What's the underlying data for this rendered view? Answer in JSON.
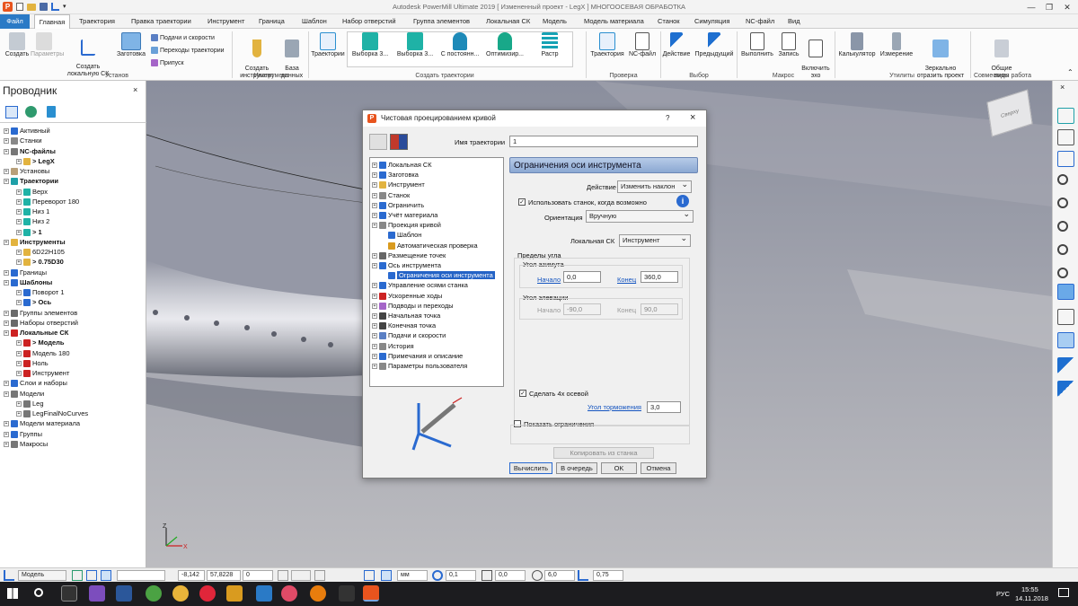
{
  "window": {
    "title": "Autodesk PowerMill Ultimate 2019   [ Измененный проект - LegX ]   МНОГООСЕВАЯ ОБРАБОТКА",
    "quick_access": "▾"
  },
  "menu_tabs": [
    "Файл",
    "Главная",
    "Траектория",
    "Правка траектории",
    "Инструмент",
    "Граница",
    "Шаблон",
    "Набор отверстий",
    "Группа элементов",
    "Локальная СК",
    "Модель",
    "Модель материала",
    "Станок",
    "Симуляция",
    "NC-файл",
    "Вид"
  ],
  "ribbon": {
    "buttons": {
      "create": "Создать",
      "params": "Параметры",
      "create_lcs": "Создать\nлокальную СК",
      "stock": "Заготовка",
      "feeds": "Подачи и скорости",
      "transitions": "Переходы траектории",
      "allowance": "Припуск",
      "create_tool": "Создать\nинструмент",
      "database": "База\nданных",
      "toolpaths": "Траектории",
      "g1": "Выборка 3...",
      "g2": "Выборка 3...",
      "g3": "С постоянн...",
      "g4": "Оптимизир...",
      "g5": "Растр",
      "verify_tp": "Траектория",
      "verify_nc": "NC-файл",
      "select_action": "Действие",
      "select_prev": "Предыдущий",
      "run": "Выполнить",
      "record": "Запись",
      "echo": "Включить\nэхо",
      "calculator": "Калькулятор",
      "measure": "Измерение",
      "mirror": "Зеркально\nотразить проект",
      "shared_views": "Общие\nвиды"
    },
    "groups": {
      "setup": "Установ",
      "tool": "Инструмент",
      "create_toolpaths": "Создать траектории",
      "verify": "Проверка",
      "selection": "Выбор",
      "macro": "Макрос",
      "utilities": "Утилиты",
      "collab": "Совместная работа"
    }
  },
  "explorer": {
    "title": "Проводник",
    "close": "×",
    "rows": [
      {
        "text": "Активный",
        "bold": false,
        "indent": 0
      },
      {
        "text": "Станки",
        "bold": false,
        "indent": 0
      },
      {
        "text": "NC-файлы",
        "bold": true,
        "indent": 0
      },
      {
        "text": "> LegX",
        "bold": true,
        "indent": 1
      },
      {
        "text": "Установы",
        "bold": false,
        "indent": 0
      },
      {
        "text": "Траектории",
        "bold": true,
        "indent": 0
      },
      {
        "text": "Верх",
        "bold": false,
        "indent": 1
      },
      {
        "text": "Переворот 180",
        "bold": false,
        "indent": 1
      },
      {
        "text": "Низ 1",
        "bold": false,
        "indent": 1
      },
      {
        "text": "Низ 2",
        "bold": false,
        "indent": 1
      },
      {
        "text": "> 1",
        "bold": true,
        "indent": 1
      },
      {
        "text": "Инструменты",
        "bold": true,
        "indent": 0
      },
      {
        "text": "6D22H105",
        "bold": false,
        "indent": 1
      },
      {
        "text": "> 0.75D30",
        "bold": true,
        "indent": 1
      },
      {
        "text": "Границы",
        "bold": false,
        "indent": 0
      },
      {
        "text": "Шаблоны",
        "bold": true,
        "indent": 0
      },
      {
        "text": "Поворот 1",
        "bold": false,
        "indent": 1
      },
      {
        "text": "> Ось",
        "bold": true,
        "indent": 1
      },
      {
        "text": "Группы элементов",
        "bold": false,
        "indent": 0
      },
      {
        "text": "Наборы отверстий",
        "bold": false,
        "indent": 0
      },
      {
        "text": "Локальные СК",
        "bold": true,
        "indent": 0
      },
      {
        "text": "> Модель",
        "bold": true,
        "indent": 1
      },
      {
        "text": "Модель 180",
        "bold": false,
        "indent": 1
      },
      {
        "text": "Ноль",
        "bold": false,
        "indent": 1
      },
      {
        "text": "Инструмент",
        "bold": false,
        "indent": 1
      },
      {
        "text": "Слои и наборы",
        "bold": false,
        "indent": 0
      },
      {
        "text": "Модели",
        "bold": false,
        "indent": 0
      },
      {
        "text": "Leg",
        "bold": false,
        "indent": 1
      },
      {
        "text": "LegFinalNoCurves",
        "bold": false,
        "indent": 1
      },
      {
        "text": "Модели материала",
        "bold": false,
        "indent": 0
      },
      {
        "text": "Группы",
        "bold": false,
        "indent": 0
      },
      {
        "text": "Макросы",
        "bold": false,
        "indent": 0
      }
    ]
  },
  "viewcube": {
    "label": "Сверху"
  },
  "dialog": {
    "title": "Чистовая проецированием кривой",
    "help": "?",
    "close": "×",
    "name_label": "Имя траектории",
    "name_value": "1",
    "nav": [
      {
        "text": "Локальная СК",
        "indent": 0,
        "selected": false
      },
      {
        "text": "Заготовка",
        "indent": 0,
        "selected": false
      },
      {
        "text": "Инструмент",
        "indent": 0,
        "selected": false
      },
      {
        "text": "Станок",
        "indent": 0,
        "selected": false
      },
      {
        "text": "Ограничить",
        "indent": 0,
        "selected": false
      },
      {
        "text": "Учёт материала",
        "indent": 0,
        "selected": false
      },
      {
        "text": "Проекция кривой",
        "indent": 0,
        "selected": false
      },
      {
        "text": "Шаблон",
        "indent": 1,
        "selected": false
      },
      {
        "text": "Автоматическая проверка",
        "indent": 1,
        "selected": false
      },
      {
        "text": "Размещение точек",
        "indent": 0,
        "selected": false
      },
      {
        "text": "Ось инструмента",
        "indent": 0,
        "selected": false
      },
      {
        "text": "Ограничения оси инструмента",
        "indent": 1,
        "selected": true
      },
      {
        "text": "Управление осями станка",
        "indent": 0,
        "selected": false
      },
      {
        "text": "Ускоренные ходы",
        "indent": 0,
        "selected": false
      },
      {
        "text": "Подводы и переходы",
        "indent": 0,
        "selected": false
      },
      {
        "text": "Начальная точка",
        "indent": 0,
        "selected": false
      },
      {
        "text": "Конечная точка",
        "indent": 0,
        "selected": false
      },
      {
        "text": "Подачи и скорости",
        "indent": 0,
        "selected": false
      },
      {
        "text": "История",
        "indent": 0,
        "selected": false
      },
      {
        "text": "Примечания и описание",
        "indent": 0,
        "selected": false
      },
      {
        "text": "Параметры пользователя",
        "indent": 0,
        "selected": false
      }
    ],
    "panel_title": "Ограничения оси инструмента",
    "action_label": "Действие",
    "action_value": "Изменить наклон",
    "use_machine_label": "Использовать станок, когда возможно",
    "orientation_label": "Ориентация",
    "orientation_value": "Вручную",
    "lcs_label": "Локальная СК",
    "lcs_value": "Инструмент",
    "angle_limits_label": "Пределы угла",
    "azimuth_label": "Угол азимута",
    "az_start_label": "Начало",
    "az_start_value": "0,0",
    "az_end_label": "Конец",
    "az_end_value": "360,0",
    "elev_label": "Угол элевации",
    "el_start_label": "Начало",
    "el_start_value": "-90,0",
    "el_end_label": "Конец",
    "el_end_value": "90,0",
    "four_axis_label": "Сделать 4х осевой",
    "brake_angle_label": "Угол торможения",
    "brake_angle_value": "3,0",
    "show_limits_label": "Показать ограничения",
    "copy_btn": "Копировать из станка",
    "calc_btn": "Вычислить",
    "queue_btn": "В очередь",
    "ok_btn": "OK",
    "cancel_btn": "Отмена"
  },
  "statusbar": {
    "mode_value": "Модель",
    "x": "-8,142",
    "y": "57,8228",
    "z": "0",
    "units": "мм",
    "tol": "0,1",
    "thick": "0,0",
    "dia": "6,0",
    "ang": "0,75"
  },
  "taskbar": {
    "lang": "РУС",
    "time": "15:55",
    "date": "14.11.2018"
  },
  "colors": {
    "accent": "#2a7ac6",
    "panel_header": "#9ab3d6",
    "selected": "#2463c6"
  }
}
